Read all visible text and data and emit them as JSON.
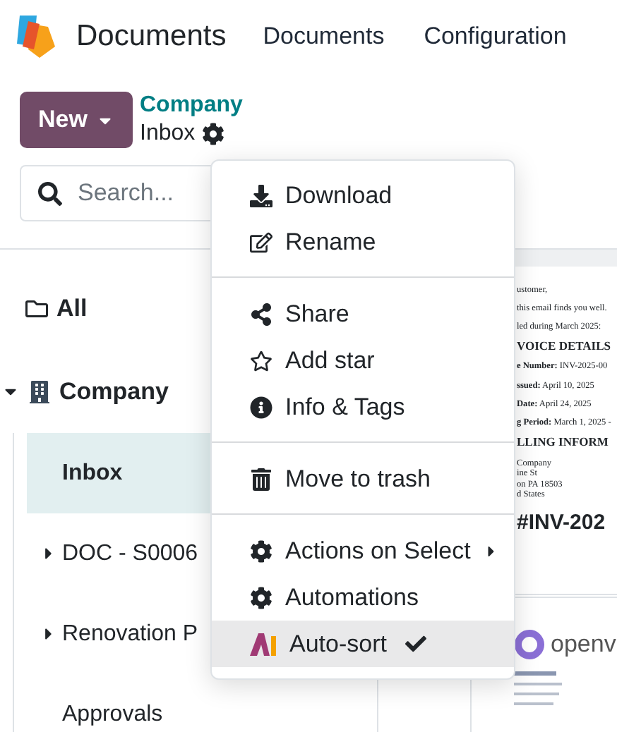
{
  "app": {
    "title": "Documents"
  },
  "nav": [
    "Documents",
    "Configuration"
  ],
  "control_panel": {
    "new_button": "New",
    "breadcrumb": {
      "parent": "Company",
      "current": "Inbox"
    },
    "search": {
      "placeholder": "Search..."
    }
  },
  "sidebar": {
    "items": [
      {
        "label": "All",
        "selected": false
      },
      {
        "label": "Company",
        "selected": false,
        "expanded": true,
        "children": [
          {
            "label": "Inbox",
            "selected": true
          },
          {
            "label": "DOC - S0006",
            "selected": false,
            "expanded": false
          },
          {
            "label": "Renovation P",
            "selected": false,
            "expanded": false
          },
          {
            "label": "Approvals",
            "selected": false
          }
        ]
      }
    ]
  },
  "menu": {
    "groups": [
      {
        "items": [
          {
            "label": "Download",
            "selected": false,
            "checked": false,
            "submenu": false
          },
          {
            "label": "Rename",
            "selected": false,
            "checked": false,
            "submenu": false
          }
        ]
      },
      {
        "items": [
          {
            "label": "Share",
            "selected": false,
            "checked": false,
            "submenu": false
          },
          {
            "label": "Add star",
            "selected": false,
            "checked": false,
            "submenu": false
          },
          {
            "label": "Info & Tags",
            "selected": false,
            "checked": false,
            "submenu": false
          }
        ]
      },
      {
        "items": [
          {
            "label": "Move to trash",
            "selected": false,
            "checked": false,
            "submenu": false
          }
        ]
      },
      {
        "items": [
          {
            "label": "Actions on Select",
            "selected": false,
            "checked": false,
            "submenu": true
          },
          {
            "label": "Automations",
            "selected": false,
            "checked": false,
            "submenu": false
          },
          {
            "label": "Auto-sort",
            "selected": true,
            "checked": true,
            "submenu": false
          }
        ]
      }
    ]
  },
  "preview": {
    "lines": [
      {
        "kind": "text",
        "text": "ustomer,"
      },
      {
        "kind": "text",
        "text": "this email finds you well."
      },
      {
        "kind": "tight",
        "text": "led during March 2025:"
      },
      {
        "kind": "heading",
        "text": "VOICE DETAILS"
      },
      {
        "kind": "text",
        "text": "**e Number:** INV-2025-00"
      },
      {
        "kind": "text",
        "text": "**ssued:** April 10, 2025"
      },
      {
        "kind": "text",
        "text": "**Date:** April 24, 2025"
      },
      {
        "kind": "text",
        "text": "**g Period:** March 1, 2025 -"
      },
      {
        "kind": "heading",
        "text": "LLING INFORM"
      },
      {
        "kind": "tight",
        "text": "Company"
      },
      {
        "kind": "tight",
        "text": "ine St"
      },
      {
        "kind": "tight",
        "text": "on PA 18503"
      },
      {
        "kind": "tight",
        "text": "d States"
      },
      {
        "kind": "big",
        "text": "#INV-202"
      }
    ],
    "logo_text": "openv"
  }
}
